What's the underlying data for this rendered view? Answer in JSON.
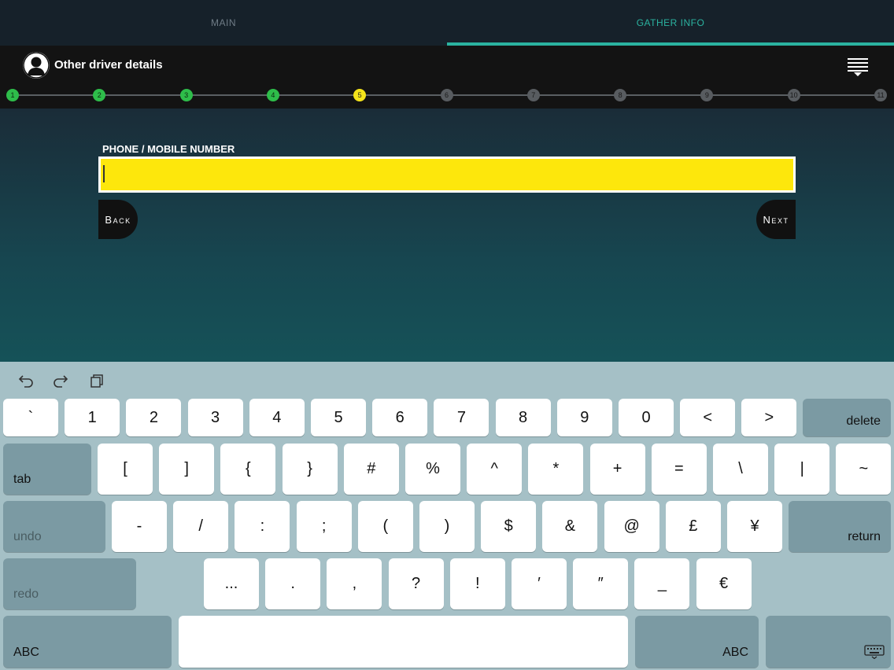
{
  "tabs": [
    {
      "label": "MAIN",
      "active": false
    },
    {
      "label": "GATHER INFO",
      "active": true
    }
  ],
  "header": {
    "title": "Other driver details",
    "avatar_icon": "user-silhouette-icon",
    "menu_icon": "menu-dropdown-icon"
  },
  "steps": {
    "items": [
      "1",
      "2",
      "3",
      "4",
      "5",
      "6",
      "7",
      "8",
      "9",
      "10",
      "11"
    ],
    "completed": 4,
    "current": 5,
    "colors": {
      "done": "#2ebd4a",
      "current": "#f5e41a",
      "pending": "#585c60"
    }
  },
  "form": {
    "label": "PHONE / MOBILE NUMBER",
    "value": "",
    "back_label": "Back",
    "next_label": "Next",
    "input_color": "#fde70c"
  },
  "keyboard": {
    "toolbar": [
      "undo-arrow-icon",
      "redo-arrow-icon",
      "paste-icon"
    ],
    "row1": [
      "`",
      "1",
      "2",
      "3",
      "4",
      "5",
      "6",
      "7",
      "8",
      "9",
      "0",
      "<",
      ">"
    ],
    "delete": "delete",
    "tab": "tab",
    "row2": [
      "[",
      "]",
      "{",
      "}",
      "#",
      "%",
      "^",
      "*",
      "+",
      "=",
      "\\",
      "|",
      "~"
    ],
    "undo": "undo",
    "row3": [
      "-",
      "/",
      ":",
      ";",
      "(",
      ")",
      "$",
      "&",
      "@",
      "£",
      "¥"
    ],
    "return": "return",
    "redo": "redo",
    "row4": [
      "...",
      ".",
      ",",
      "?",
      "!",
      "′",
      "″",
      "_",
      "€"
    ],
    "abc_left": "ABC",
    "abc_right": "ABC",
    "dismiss_icon": "keyboard-dismiss-icon"
  }
}
